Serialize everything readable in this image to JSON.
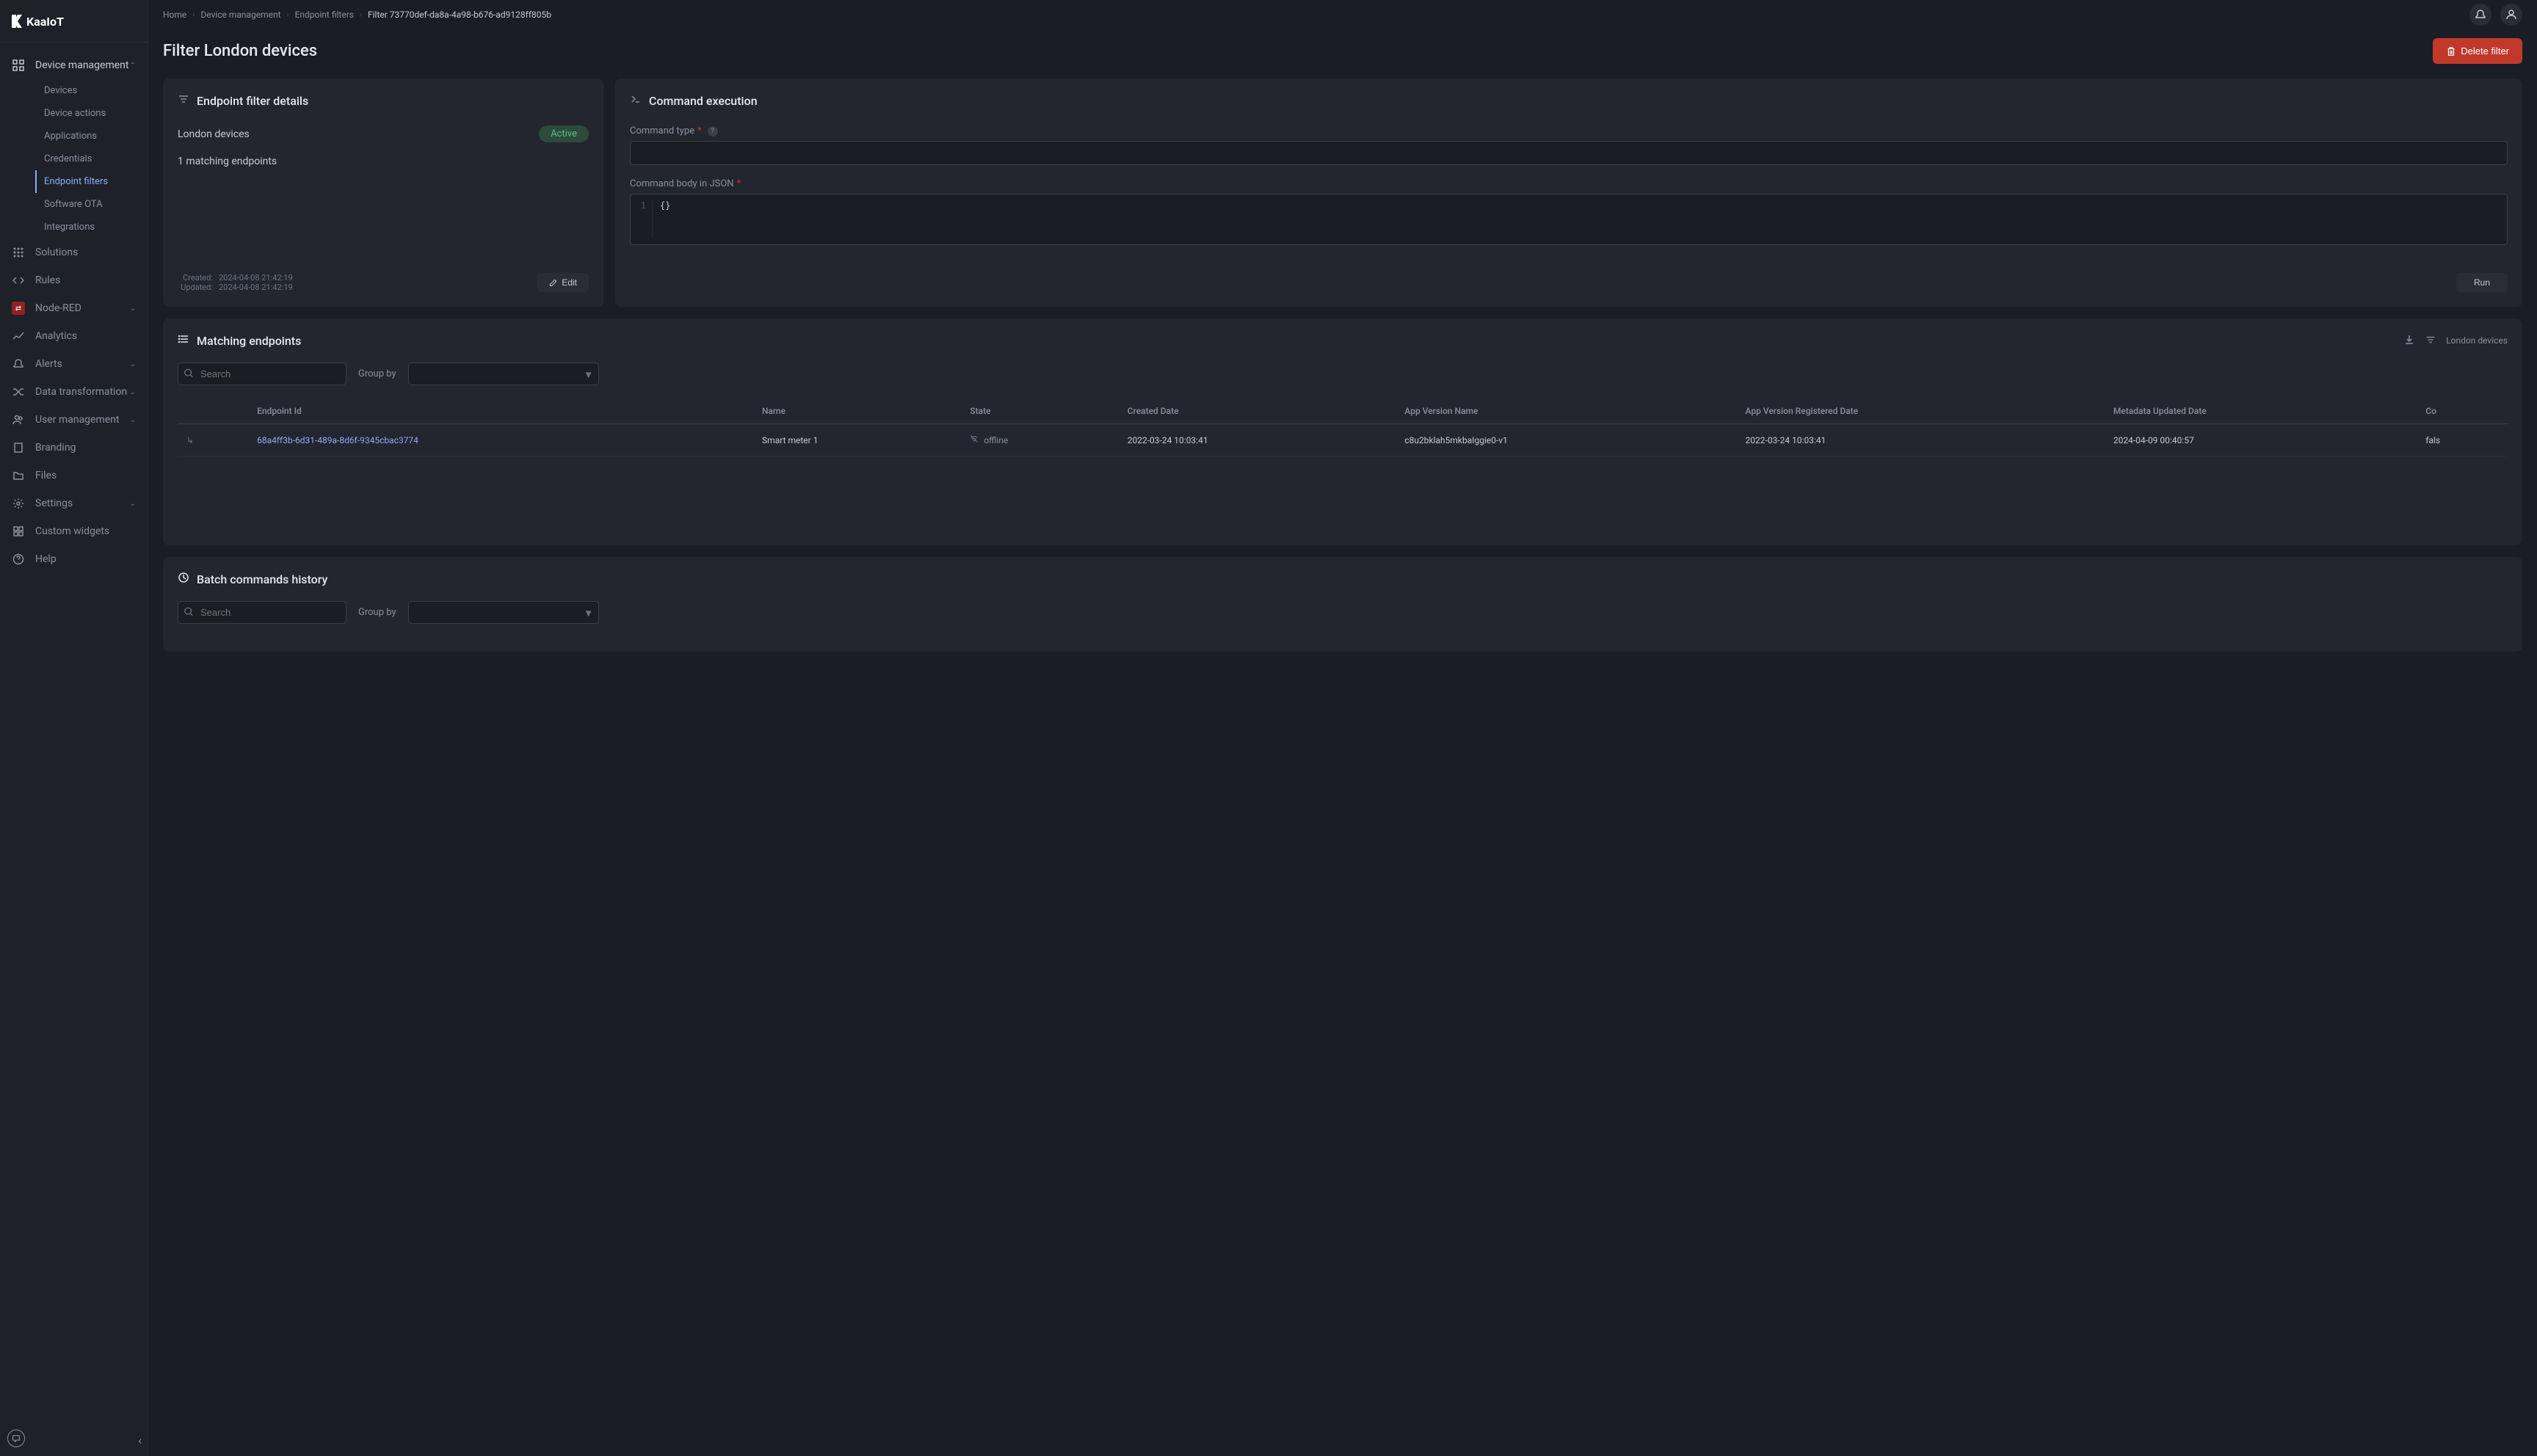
{
  "breadcrumb": {
    "items": [
      "Home",
      "Device management",
      "Endpoint filters"
    ],
    "current": "Filter 73770def-da8a-4a98-b676-ad9128ff805b"
  },
  "page": {
    "title": "Filter London devices",
    "delete_label": "Delete filter"
  },
  "sidebar": {
    "items": [
      {
        "label": "Device management",
        "expandable": true
      },
      {
        "label": "Solutions"
      },
      {
        "label": "Rules"
      },
      {
        "label": "Node-RED"
      },
      {
        "label": "Analytics"
      },
      {
        "label": "Alerts"
      },
      {
        "label": "Data transformation"
      },
      {
        "label": "User management"
      },
      {
        "label": "Branding"
      },
      {
        "label": "Files"
      },
      {
        "label": "Settings"
      },
      {
        "label": "Custom widgets"
      },
      {
        "label": "Help"
      }
    ],
    "device_mgmt_sub": [
      "Devices",
      "Device actions",
      "Applications",
      "Credentials",
      "Endpoint filters",
      "Software OTA",
      "Integrations"
    ]
  },
  "details_panel": {
    "title": "Endpoint filter details",
    "name": "London devices",
    "status": "Active",
    "matching": "1 matching endpoints",
    "created_key": "Created:",
    "created_val": "2024-04-08 21:42:19",
    "updated_key": "Updated:",
    "updated_val": "2024-04-08 21:42:19",
    "edit_label": "Edit"
  },
  "command_panel": {
    "title": "Command execution",
    "type_label": "Command type",
    "body_label": "Command body in JSON",
    "body_value": "{}",
    "run_label": "Run"
  },
  "endpoints_section": {
    "title": "Matching endpoints",
    "filter_name": "London devices",
    "search_placeholder": "Search",
    "groupby_label": "Group by",
    "columns": [
      "",
      "Endpoint Id",
      "Name",
      "State",
      "Created Date",
      "App Version Name",
      "App Version Registered Date",
      "Metadata Updated Date",
      "Co"
    ],
    "rows": [
      {
        "endpoint_id": "68a4ff3b-6d31-489a-8d6f-9345cbac3774",
        "name": "Smart meter 1",
        "state": "offline",
        "created": "2022-03-24 10:03:41",
        "app_version_name": "c8u2bklah5mkbaIggie0-v1",
        "app_version_registered": "2022-03-24 10:03:41",
        "metadata_updated": "2024-04-09 00:40:57",
        "co": "fals"
      }
    ]
  },
  "history_section": {
    "title": "Batch commands history",
    "search_placeholder": "Search",
    "groupby_label": "Group by"
  }
}
